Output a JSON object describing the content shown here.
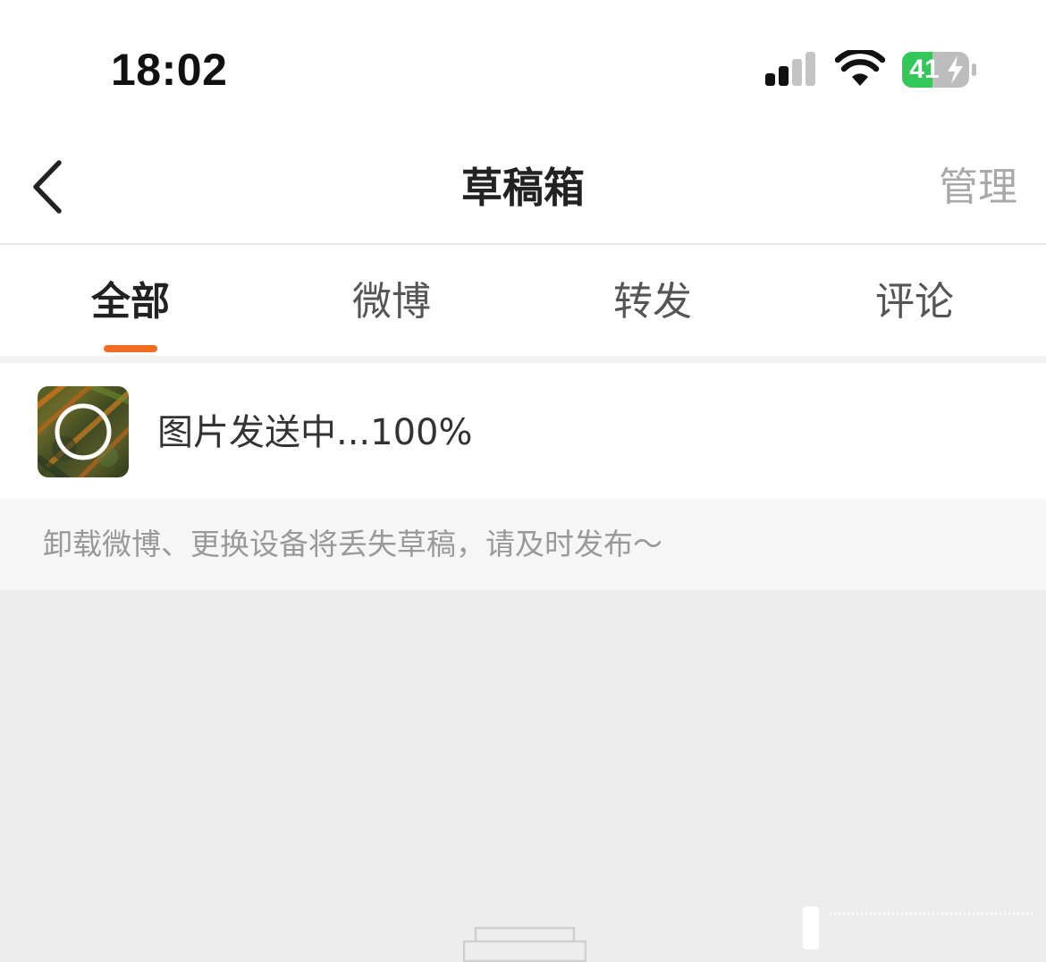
{
  "status_bar": {
    "time": "18:02",
    "battery_level": "41",
    "icons": [
      "cellular-signal-icon",
      "wifi-icon",
      "battery-charging-icon"
    ]
  },
  "nav": {
    "title": "草稿箱",
    "manage_label": "管理",
    "back_icon": "chevron-left-icon"
  },
  "tabs": [
    {
      "label": "全部",
      "active": true
    },
    {
      "label": "微博",
      "active": false
    },
    {
      "label": "转发",
      "active": false
    },
    {
      "label": "评论",
      "active": false
    }
  ],
  "drafts": [
    {
      "status_text": "图片发送中...100%",
      "progress": 1.0,
      "thumb_icon": "upload-progress-ring-icon"
    }
  ],
  "hint": {
    "text": "卸载微博、更换设备将丢失草稿，请及时发布～"
  },
  "colors": {
    "accent": "#f26c1f",
    "battery_green": "#34c759",
    "manage_gray": "#a8a8a8",
    "hint_gray": "#999999"
  }
}
